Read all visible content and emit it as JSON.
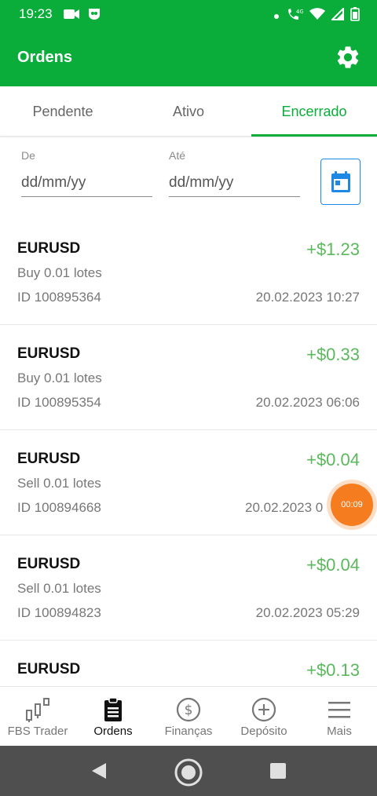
{
  "status_bar": {
    "time": "19:23",
    "network": "4G"
  },
  "app_bar": {
    "title": "Ordens"
  },
  "tabs": [
    {
      "label": "Pendente",
      "active": false
    },
    {
      "label": "Ativo",
      "active": false
    },
    {
      "label": "Encerrado",
      "active": true
    }
  ],
  "filters": {
    "from_label": "De",
    "from_placeholder": "dd/mm/yy",
    "to_label": "Até",
    "to_placeholder": "dd/mm/yy"
  },
  "orders": [
    {
      "symbol": "EURUSD",
      "profit": "+$1.23",
      "detail": "Buy  0.01 lotes",
      "id": "ID 100895364",
      "date": "20.02.2023 10:27"
    },
    {
      "symbol": "EURUSD",
      "profit": "+$0.33",
      "detail": "Buy  0.01 lotes",
      "id": "ID 100895354",
      "date": "20.02.2023 06:06"
    },
    {
      "symbol": "EURUSD",
      "profit": "+$0.04",
      "detail": "Sell  0.01 lotes",
      "id": "ID 100894668",
      "date": "20.02.2023 0"
    },
    {
      "symbol": "EURUSD",
      "profit": "+$0.04",
      "detail": "Sell  0.01 lotes",
      "id": "ID 100894823",
      "date": "20.02.2023 05:29"
    },
    {
      "symbol": "EURUSD",
      "profit": "+$0.13",
      "detail": "",
      "id": "",
      "date": ""
    }
  ],
  "floating_timer": "00:09",
  "bottom_nav": [
    {
      "label": "FBS Trader",
      "icon": "chart-icon",
      "active": false
    },
    {
      "label": "Ordens",
      "icon": "clipboard-icon",
      "active": true
    },
    {
      "label": "Finanças",
      "icon": "dollar-icon",
      "active": false
    },
    {
      "label": "Depósito",
      "icon": "plus-circle-icon",
      "active": false
    },
    {
      "label": "Mais",
      "icon": "menu-icon",
      "active": false
    }
  ],
  "colors": {
    "brand_green": "#0aad3a",
    "profit_green": "#5cb85c",
    "accent_blue": "#1e88e5",
    "timer_orange": "#f57c1f"
  }
}
